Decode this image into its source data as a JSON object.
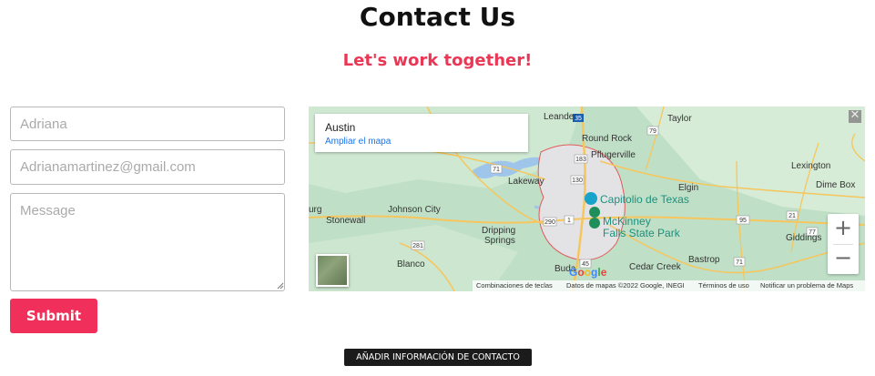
{
  "header": {
    "title": "Contact Us",
    "subtitle": "Let's work together!"
  },
  "form": {
    "name_placeholder": "Adriana",
    "email_placeholder": "Adrianamartinez@gmail.com",
    "message_placeholder": "Message",
    "submit_label": "Submit"
  },
  "map": {
    "info_title": "Austin",
    "info_link": "Ampliar el mapa",
    "zoom_in": "+",
    "zoom_out": "−",
    "fullscreen_icon": "close-icon",
    "labels": {
      "leander": "Leander",
      "taylor": "Taylor",
      "round_rock": "Round Rock",
      "pflugerville": "Pflugerville",
      "lakeway": "Lakeway",
      "elgin": "Elgin",
      "lexington": "Lexington",
      "dime_box": "Dime Box",
      "johnson_city": "Johnson City",
      "stonewall": "Stonewall",
      "dripping": "Dripping",
      "springs": "Springs",
      "capitolio": "Capitolio de Texas",
      "mckinney": "McKinney",
      "falls_state_park": "Falls State Park",
      "bastrop": "Bastrop",
      "giddings": "Giddings",
      "blanco": "Blanco",
      "cedar_creek": "Cedar Creek",
      "buda": "Buda",
      "burg": "urg"
    },
    "shields": [
      "35",
      "79",
      "183",
      "130",
      "71",
      "290",
      "1",
      "281",
      "45",
      "21",
      "77",
      "71",
      "95"
    ],
    "google_logo": "Google",
    "attribution": {
      "shortcuts": "Combinaciones de teclas",
      "data": "Datos de mapas ©2022 Google, INEGI",
      "terms": "Términos de uso",
      "report": "Notificar un problema de Maps"
    }
  },
  "footer": {
    "add_contact_info": "AÑADIR INFORMACIÓN DE CONTACTO"
  },
  "colors": {
    "accent": "#f0305a",
    "subtitle": "#ea3755",
    "map_green": "#bfe0c7"
  }
}
